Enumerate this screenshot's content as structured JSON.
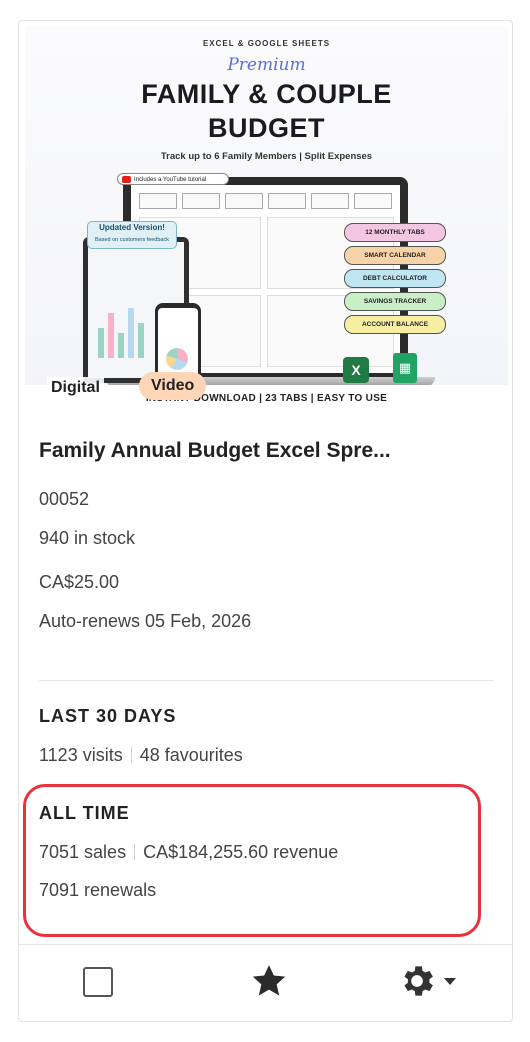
{
  "thumbnail": {
    "top_text": "EXCEL & GOOGLE SHEETS",
    "script_text": "Premium",
    "title_line1": "FAMILY & COUPLE",
    "title_line2": "BUDGET",
    "subtitle": "Track up to 6 Family Members | Split Expenses",
    "youtube_badge": "Includes a YouTube tutorial",
    "updated_title": "Updated Version!",
    "updated_sub": "Based on customers feedback",
    "pills": [
      {
        "label": "12 MONTHLY TABS",
        "color": "#f3c6e2"
      },
      {
        "label": "SMART CALENDAR",
        "color": "#f8d3a8"
      },
      {
        "label": "DEBT CALCULATOR",
        "color": "#bfe6f2"
      },
      {
        "label": "SAVINGS TRACKER",
        "color": "#c9efc6"
      },
      {
        "label": "ACCOUNT BALANCE",
        "color": "#f6efa3"
      }
    ],
    "bottom_strip": "INSTANT DOWNLOAD | 23 TABS | EASY TO USE",
    "digital_label": "Digital",
    "video_badge": "Video",
    "excel_icon": "excel-icon",
    "sheets_icon": "google-sheets-icon"
  },
  "listing": {
    "title": "Family Annual Budget Excel Spre...",
    "sku": "00052",
    "stock": "940 in stock",
    "price": "CA$25.00",
    "renewal": "Auto-renews 05 Feb, 2026"
  },
  "last30": {
    "heading": "LAST 30 DAYS",
    "visits": "1123 visits",
    "favourites": "48 favourites"
  },
  "alltime": {
    "heading": "ALL TIME",
    "sales": "7051 sales",
    "revenue": "CA$184,255.60 revenue",
    "renewals": "7091 renewals"
  },
  "footer": {
    "checkbox_icon": "checkbox",
    "star_icon": "star-icon",
    "gear_icon": "gear-icon",
    "dropdown_icon": "caret-down-icon"
  },
  "colors": {
    "highlight": "#e8323c",
    "video_badge": "#ffd5b8"
  }
}
